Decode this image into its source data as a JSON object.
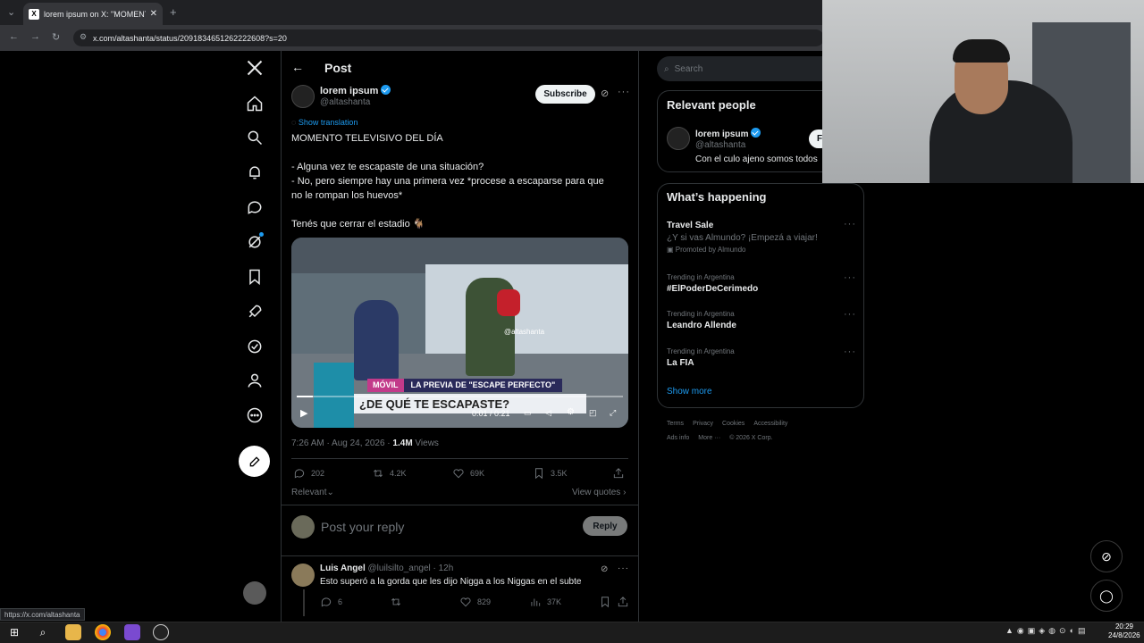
{
  "browser": {
    "tab_title": "lorem ipsum on X: \"MOMENTO",
    "url": "x.com/altashanta/status/2091834651262222608?s=20",
    "status_url": "https://x.com/altashanta"
  },
  "header": {
    "title": "Post"
  },
  "post": {
    "author_name": "lorem ipsum",
    "author_handle": "@altashanta",
    "subscribe_label": "Subscribe",
    "show_translation": "Show translation",
    "text_lines": [
      "MOMENTO TELEVISIVO DEL DÍA",
      "",
      "- Alguna vez te escapaste de una situación?",
      "- No, pero siempre hay una primera vez *procese a escaparse para que",
      "no le rompan los huevos*",
      "",
      "Tenés que cerrar el estadio 🐐"
    ],
    "video": {
      "watermark": "@altashanta",
      "banner_tag": "MÓVIL",
      "banner_text": "LA PREVIA DE \"ESCAPE PERFECTO\"",
      "caption": "¿DE QUÉ TE ESCAPASTE?",
      "time": "0:01 / 0:21",
      "progress": 0.05
    },
    "meta_time": "7:26 AM · Aug 24, 2026 · ",
    "views_count": "1.4M",
    "views_label": " Views",
    "replies": "202",
    "reposts": "4.2K",
    "likes": "69K",
    "bookmarks": "3.5K",
    "sort_label": "Relevant",
    "view_quotes": "View quotes"
  },
  "reply_box": {
    "placeholder": "Post your reply",
    "button": "Reply"
  },
  "comment": {
    "name": "Luis Angel",
    "handle": "@luilsilto_angel",
    "time": "· 12h",
    "text": "Esto superó a la gorda que les dijo Nigga a los Niggas en el subte",
    "replies": "6",
    "likes": "829",
    "views": "37K"
  },
  "search": {
    "placeholder": "Search"
  },
  "relevant": {
    "title": "Relevant people",
    "name": "lorem ipsum",
    "handle": "@altashanta",
    "bio": "Con el culo ajeno somos todos",
    "follow": "F"
  },
  "happening": {
    "title": "What’s happening",
    "trends": [
      {
        "context": "",
        "name": "Travel Sale",
        "sub": "¿Y si vas Almundo? ¡Empezá a viajar!",
        "promo": "Promoted by Almundo"
      },
      {
        "context": "Trending in Argentina",
        "name": "#ElPoderDeCerimedo",
        "sub": "",
        "promo": ""
      },
      {
        "context": "Trending in Argentina",
        "name": "Leandro Allende",
        "sub": "",
        "promo": ""
      },
      {
        "context": "Trending in Argentina",
        "name": "La FIA",
        "sub": "",
        "promo": ""
      }
    ],
    "show_more": "Show more"
  },
  "footer": {
    "row1": [
      "Terms",
      "Privacy",
      "Cookies",
      "Accessibility"
    ],
    "row2": [
      "Ads info",
      "More ···",
      "© 2026 X Corp."
    ]
  },
  "taskbar": {
    "time": "20:29",
    "date": "24/8/2026"
  },
  "colors": {
    "accent": "#1d9bf0",
    "bg": "#000000",
    "border": "#2f3336",
    "muted": "#71767b"
  }
}
